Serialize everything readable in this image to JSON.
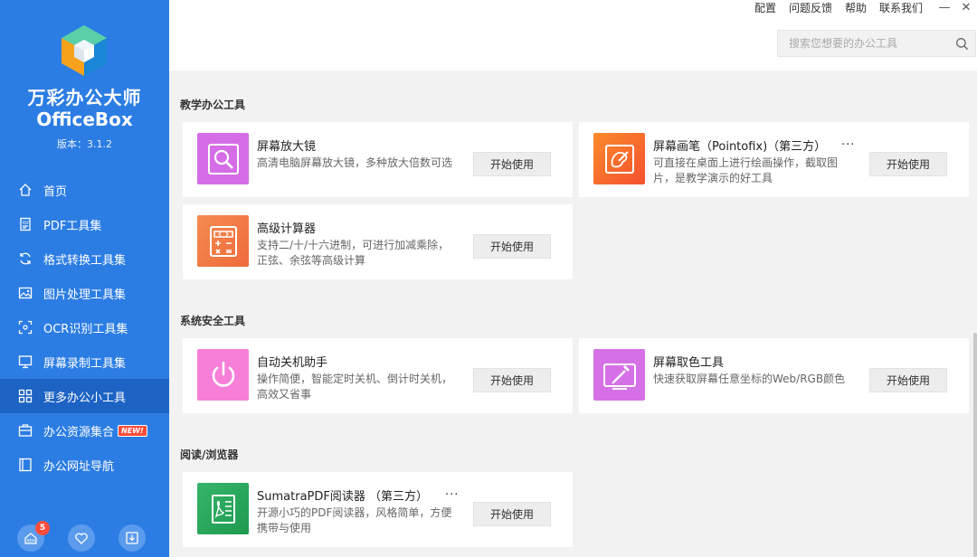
{
  "app": {
    "name": "万彩办公大师",
    "name_en": "OfficeBox",
    "version": "版本：3.1.2"
  },
  "sidebar": {
    "items": [
      {
        "label": "首页",
        "icon": "home-icon"
      },
      {
        "label": "PDF工具集",
        "icon": "pdf-icon"
      },
      {
        "label": "格式转换工具集",
        "icon": "convert-icon"
      },
      {
        "label": "图片处理工具集",
        "icon": "image-icon"
      },
      {
        "label": "OCR识别工具集",
        "icon": "ocr-icon"
      },
      {
        "label": "屏幕录制工具集",
        "icon": "screen-record-icon"
      },
      {
        "label": "更多办公小工具",
        "icon": "more-tools-icon",
        "active": true
      },
      {
        "label": "办公资源集合",
        "icon": "resources-icon",
        "badge": "NEW!"
      },
      {
        "label": "办公网址导航",
        "icon": "nav-icon"
      }
    ],
    "bottom": {
      "news_count": "5"
    }
  },
  "header": {
    "links": [
      "配置",
      "问题反馈",
      "帮助",
      "联系我们"
    ],
    "window": {
      "minimize": "—",
      "close": "✕"
    },
    "search_placeholder": "搜索您想要的办公工具"
  },
  "sections": [
    {
      "title": "教学办公工具",
      "cards": [
        {
          "title": "屏幕放大镜",
          "desc": "高清电脑屏幕放大镜，多种放大倍数可选",
          "button": "开始使用",
          "icon": "magnifier-icon"
        },
        {
          "title": "屏幕画笔（Pointofix)（第三方）",
          "dots": "...",
          "desc": "可直接在桌面上进行绘画操作，截取图片，是教学演示的好工具",
          "button": "开始使用",
          "icon": "palette-icon"
        },
        {
          "title": "高级计算器",
          "desc": "支持二/十/十六进制，可进行加减乘除，正弦、余弦等高级计算",
          "button": "开始使用",
          "icon": "calculator-icon"
        }
      ]
    },
    {
      "title": "系统安全工具",
      "cards": [
        {
          "title": "自动关机助手",
          "desc": "操作简便，智能定时关机、倒计时关机，高效又省事",
          "button": "开始使用",
          "icon": "power-icon"
        },
        {
          "title": "屏幕取色工具",
          "desc": "快速获取屏幕任意坐标的Web/RGB颜色",
          "button": "开始使用",
          "icon": "color-picker-icon"
        }
      ]
    },
    {
      "title": "阅读/浏览器",
      "cards": [
        {
          "title": "SumatraPDF阅读器 （第三方）",
          "dots": "...",
          "desc": "开源小巧的PDF阅读器，风格简单，方便携带与使用",
          "button": "开始使用",
          "icon": "pdf-reader-icon"
        }
      ]
    }
  ],
  "colors": {
    "sidebar_bg": "#2c7de3",
    "sidebar_active": "#1d63c4",
    "magnifier": "#d56ee6",
    "palette": "#f96b2e",
    "calculator": "#f07845",
    "power": "#f77fd8",
    "color_picker": "#d670e6",
    "pdf_reader": "#25a459"
  }
}
